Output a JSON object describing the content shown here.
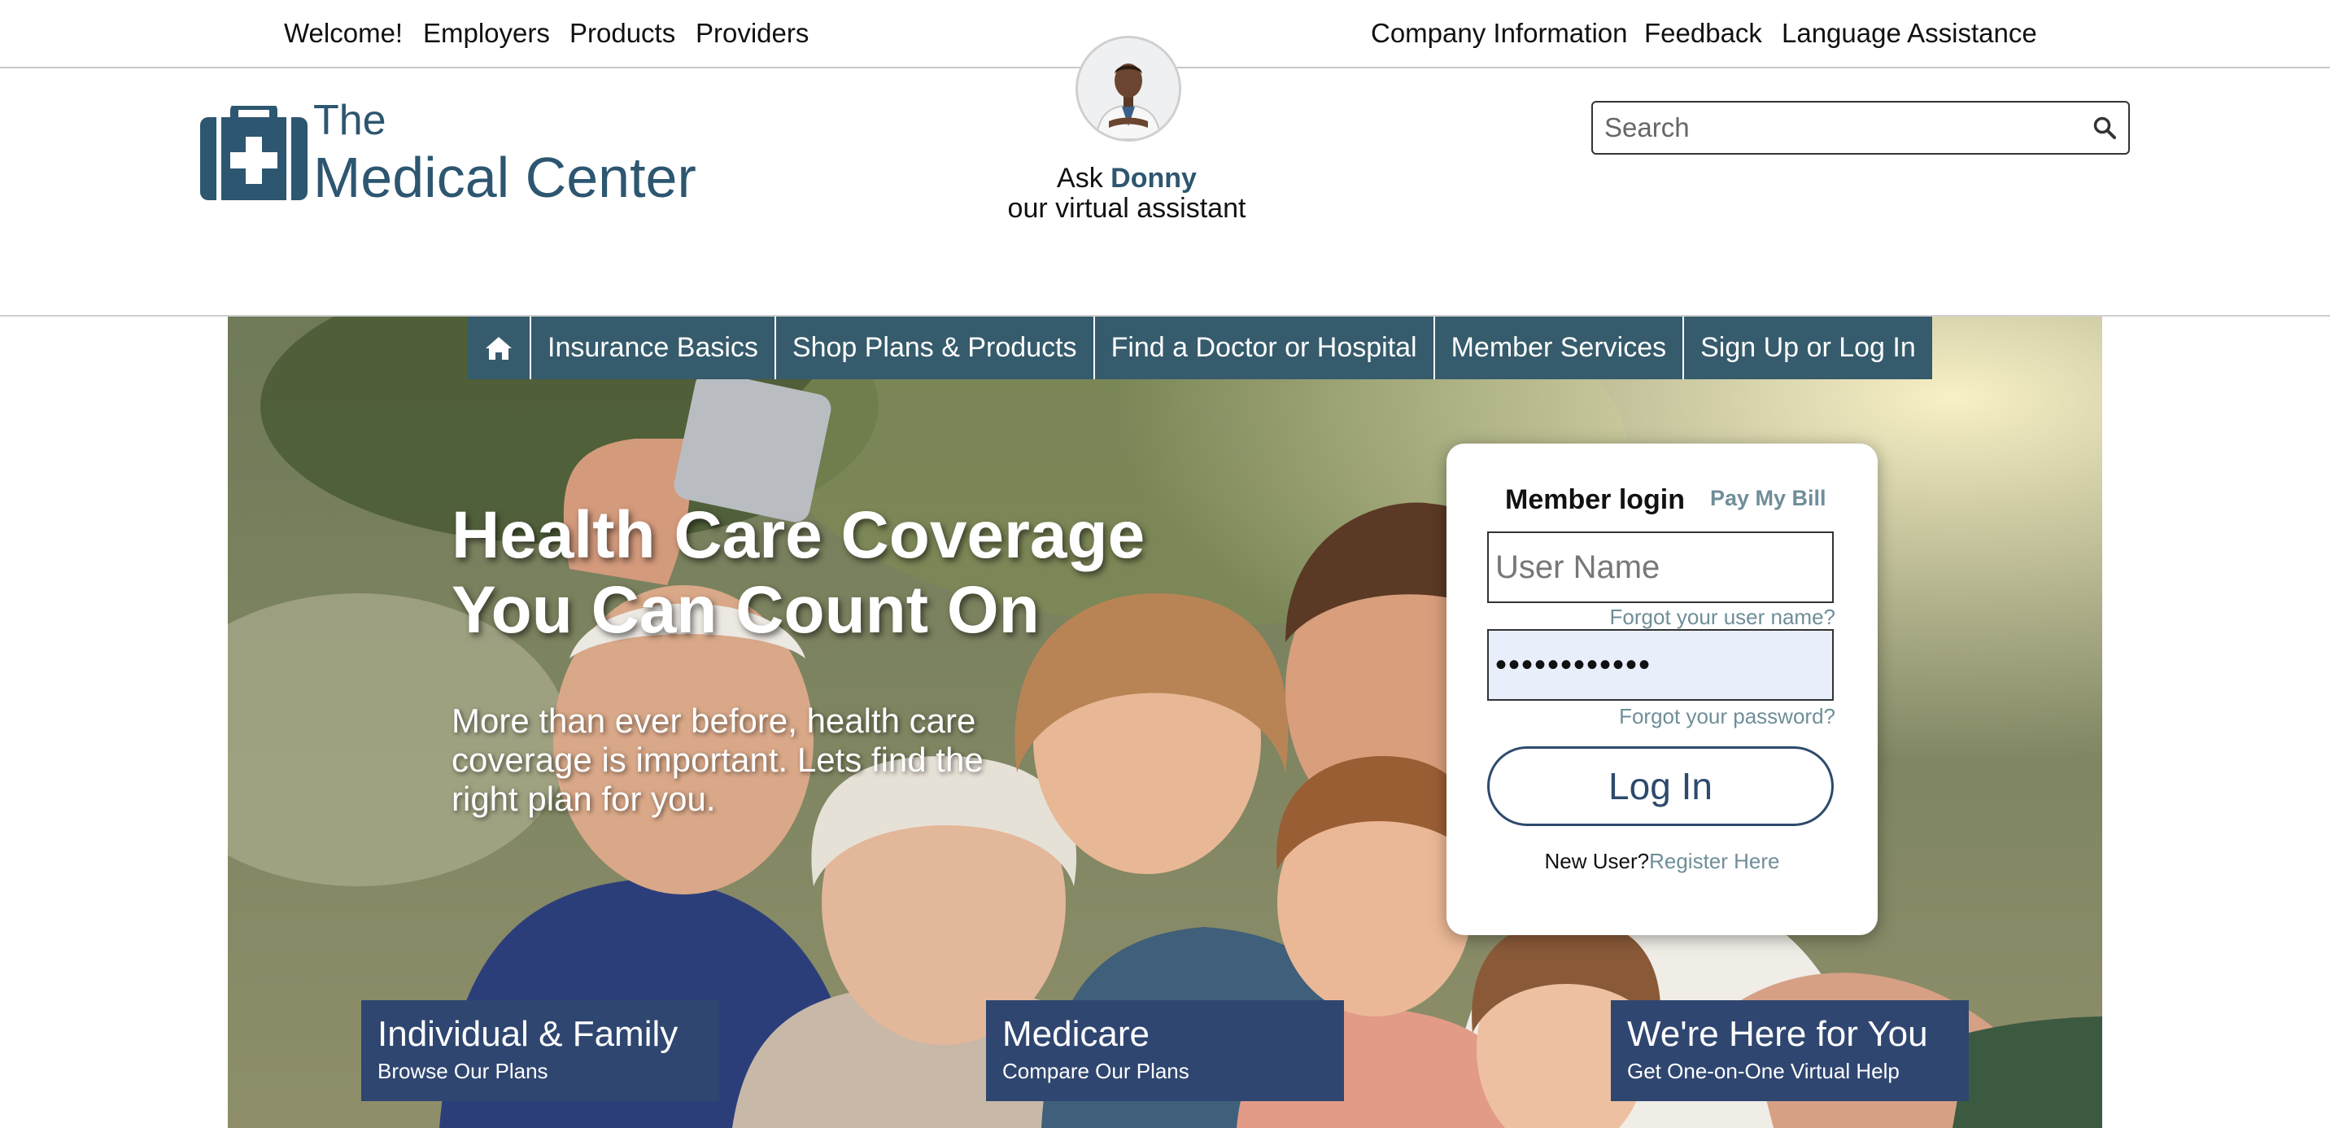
{
  "topbar": {
    "links_left": [
      "Welcome!",
      "Employers",
      "Products",
      "Providers"
    ],
    "links_right": [
      "Company Information",
      "Feedback",
      "Language Assistance"
    ]
  },
  "logo": {
    "line1": "The",
    "line2": "Medical Center"
  },
  "assistant": {
    "ask": "Ask",
    "name": "Donny",
    "subtitle": "our virtual assistant"
  },
  "search": {
    "placeholder": "Search",
    "icon": "search-icon"
  },
  "nav": {
    "home_icon": "home-icon",
    "items": [
      "Insurance Basics",
      "Shop Plans & Products",
      "Find a Doctor or Hospital",
      "Member Services",
      "Sign Up or Log In"
    ]
  },
  "hero": {
    "headline_line1": "Health Care Coverage",
    "headline_line2": "You Can Count On",
    "subtext": "More than ever before, health care coverage is important. Lets find the right plan for you."
  },
  "login": {
    "tab_active": "Member login",
    "tab_other": "Pay My Bill",
    "username_placeholder": "User Name",
    "forgot_username": "Forgot your user name?",
    "password_value": "••••••••••••",
    "forgot_password": "Forgot your password?",
    "button": "Log In",
    "new_user": "New User?",
    "register": "Register Here"
  },
  "tiles": [
    {
      "title": "Individual & Family",
      "subtitle": "Browse Our Plans"
    },
    {
      "title": "Medicare",
      "subtitle": "Compare Our Plans"
    },
    {
      "title": "We're Here for You",
      "subtitle": "Get One-on-One Virtual Help"
    }
  ],
  "colors": {
    "brand": "#2d5670",
    "nav": "#355b6c",
    "tile": "#2f4670",
    "link_muted": "#6f8e99"
  }
}
